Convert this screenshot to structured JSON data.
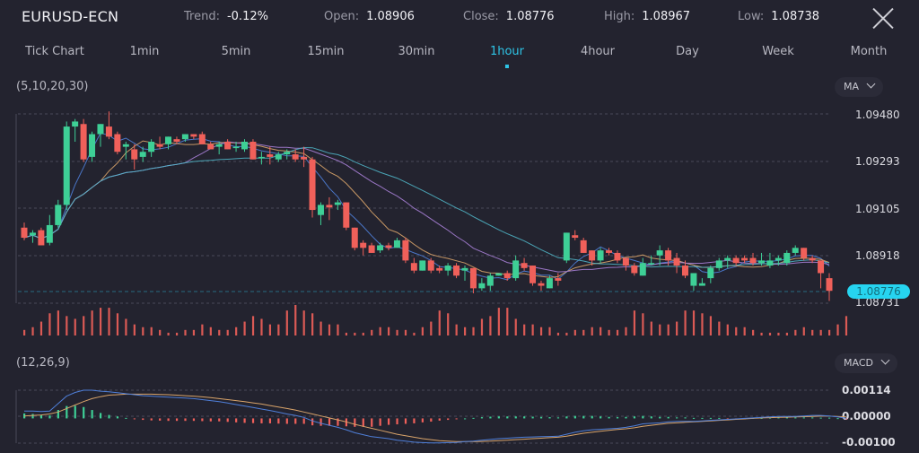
{
  "header": {
    "symbol": "EURUSD-ECN",
    "trend_label": "Trend:",
    "trend_value": "-0.12%",
    "open_label": "Open:",
    "open_value": "1.08906",
    "close_label": "Close:",
    "close_value": "1.08776",
    "high_label": "High:",
    "high_value": "1.08967",
    "low_label": "Low:",
    "low_value": "1.08738",
    "close_icon": "close-x-icon"
  },
  "timeframes": [
    "Tick Chart",
    "1min",
    "5min",
    "15min",
    "30min",
    "1hour",
    "4hour",
    "Day",
    "Week",
    "Month"
  ],
  "active_timeframe": "1hour",
  "colors": {
    "up": "#3ecf96",
    "down": "#f0605a",
    "accent": "#2ec4e6",
    "ma5": "#4f7fd9",
    "ma10": "#d9a46a",
    "ma20": "#a77fd6",
    "ma30": "#4fb3c4",
    "macd": "#4f7fd9",
    "signal": "#d9a46a"
  },
  "main_panel": {
    "params_label": "(5,10,20,30)",
    "indicator_select": "MA"
  },
  "macd_panel": {
    "params_label": "(12,26,9)",
    "indicator_select": "MACD"
  },
  "chart_data": [
    {
      "type": "candlestick",
      "title": "EURUSD-ECN 1hour",
      "y_ticks": [
        "1.09480",
        "1.09293",
        "1.09105",
        "1.08918",
        "1.08731"
      ],
      "current_price": "1.08776",
      "ylim": [
        1.08731,
        1.0948
      ],
      "candles": [
        [
          1.0903,
          1.0905,
          1.0898,
          1.0899
        ],
        [
          1.09,
          1.0902,
          1.0897,
          1.0901
        ],
        [
          1.0902,
          1.0903,
          1.0896,
          1.0896
        ],
        [
          1.0897,
          1.0908,
          1.0896,
          1.0904
        ],
        [
          1.0904,
          1.0914,
          1.0903,
          1.0912
        ],
        [
          1.0912,
          1.0945,
          1.091,
          1.0943
        ],
        [
          1.0943,
          1.0946,
          1.0937,
          1.0945
        ],
        [
          1.0944,
          1.0946,
          1.0929,
          1.093
        ],
        [
          1.0931,
          1.0941,
          1.0929,
          1.094
        ],
        [
          1.094,
          1.0944,
          1.0935,
          1.0944
        ],
        [
          1.0943,
          1.0949,
          1.0938,
          1.0939
        ],
        [
          1.094,
          1.0941,
          1.0932,
          1.0933
        ],
        [
          1.0935,
          1.0937,
          1.093,
          1.0936
        ],
        [
          1.0934,
          1.0936,
          1.0926,
          1.093
        ],
        [
          1.0931,
          1.0935,
          1.0929,
          1.0933
        ],
        [
          1.0933,
          1.0938,
          1.0931,
          1.0937
        ],
        [
          1.0936,
          1.0939,
          1.0934,
          1.0935
        ],
        [
          1.0936,
          1.0939,
          1.0934,
          1.0939
        ],
        [
          1.0938,
          1.0939,
          1.0936,
          1.0937
        ],
        [
          1.0938,
          1.094,
          1.0937,
          1.094
        ],
        [
          1.094,
          1.094,
          1.0938,
          1.0939
        ],
        [
          1.094,
          1.0941,
          1.0936,
          1.0936
        ],
        [
          1.0936,
          1.0937,
          1.0934,
          1.0934
        ],
        [
          1.0935,
          1.0937,
          1.0932,
          1.0936
        ],
        [
          1.0937,
          1.0938,
          1.0934,
          1.0934
        ],
        [
          1.0935,
          1.0937,
          1.0933,
          1.0935
        ],
        [
          1.0934,
          1.0938,
          1.0933,
          1.0937
        ],
        [
          1.0937,
          1.0938,
          1.093,
          1.093
        ],
        [
          1.0931,
          1.0933,
          1.0928,
          1.0931
        ],
        [
          1.0932,
          1.0935,
          1.0928,
          1.0931
        ],
        [
          1.093,
          1.0933,
          1.0929,
          1.0932
        ],
        [
          1.0932,
          1.0934,
          1.093,
          1.0933
        ],
        [
          1.0932,
          1.0934,
          1.0929,
          1.093
        ],
        [
          1.0931,
          1.0935,
          1.0927,
          1.093
        ],
        [
          1.093,
          1.0931,
          1.0907,
          1.091
        ],
        [
          1.0908,
          1.0913,
          1.0904,
          1.0912
        ],
        [
          1.0912,
          1.0915,
          1.0906,
          1.0911
        ],
        [
          1.0912,
          1.0914,
          1.091,
          1.0913
        ],
        [
          1.0913,
          1.0913,
          1.0902,
          1.0903
        ],
        [
          1.0903,
          1.0903,
          1.0894,
          1.0895
        ],
        [
          1.0897,
          1.0898,
          1.0892,
          1.0895
        ],
        [
          1.0896,
          1.0897,
          1.0893,
          1.0893
        ],
        [
          1.0894,
          1.0897,
          1.0893,
          1.0896
        ],
        [
          1.0896,
          1.0897,
          1.0894,
          1.0895
        ],
        [
          1.0895,
          1.0899,
          1.0895,
          1.0898
        ],
        [
          1.0898,
          1.0899,
          1.0889,
          1.089
        ],
        [
          1.0889,
          1.0891,
          1.0885,
          1.0886
        ],
        [
          1.0886,
          1.089,
          1.0886,
          1.089
        ],
        [
          1.089,
          1.0891,
          1.0885,
          1.0886
        ],
        [
          1.0887,
          1.0888,
          1.0885,
          1.0886
        ],
        [
          1.0886,
          1.0889,
          1.0884,
          1.0888
        ],
        [
          1.0888,
          1.0889,
          1.0883,
          1.0884
        ],
        [
          1.0886,
          1.0888,
          1.0882,
          1.0887
        ],
        [
          1.0887,
          1.0887,
          1.0877,
          1.0879
        ],
        [
          1.0879,
          1.0883,
          1.0878,
          1.0881
        ],
        [
          1.088,
          1.0885,
          1.0878,
          1.0884
        ],
        [
          1.0884,
          1.0885,
          1.0884,
          1.0885
        ],
        [
          1.0885,
          1.0886,
          1.0882,
          1.0883
        ],
        [
          1.0883,
          1.0892,
          1.0882,
          1.089
        ],
        [
          1.0889,
          1.0891,
          1.0886,
          1.0887
        ],
        [
          1.0888,
          1.0888,
          1.088,
          1.0881
        ],
        [
          1.0881,
          1.0882,
          1.0878,
          1.088
        ],
        [
          1.0879,
          1.0884,
          1.0879,
          1.0883
        ],
        [
          1.0883,
          1.0885,
          1.088,
          1.0882
        ],
        [
          1.089,
          1.0901,
          1.0889,
          1.0901
        ],
        [
          1.09,
          1.0902,
          1.0898,
          1.0899
        ],
        [
          1.0898,
          1.0899,
          1.0893,
          1.0893
        ],
        [
          1.0894,
          1.0894,
          1.0888,
          1.089
        ],
        [
          1.089,
          1.0895,
          1.0889,
          1.0894
        ],
        [
          1.0894,
          1.0895,
          1.0892,
          1.0893
        ],
        [
          1.0893,
          1.0894,
          1.0889,
          1.089
        ],
        [
          1.0891,
          1.0891,
          1.0886,
          1.0888
        ],
        [
          1.0888,
          1.0889,
          1.0884,
          1.0885
        ],
        [
          1.0884,
          1.0891,
          1.0884,
          1.0889
        ],
        [
          1.0889,
          1.0892,
          1.0888,
          1.0889
        ],
        [
          1.0892,
          1.0896,
          1.0888,
          1.0894
        ],
        [
          1.0894,
          1.0895,
          1.0888,
          1.089
        ],
        [
          1.0891,
          1.0893,
          1.0885,
          1.0888
        ],
        [
          1.0888,
          1.089,
          1.0883,
          1.0884
        ],
        [
          1.088,
          1.0885,
          1.0878,
          1.0885
        ],
        [
          1.088,
          1.0883,
          1.088,
          1.0881
        ],
        [
          1.0883,
          1.0888,
          1.0881,
          1.0887
        ],
        [
          1.0887,
          1.0891,
          1.0886,
          1.089
        ],
        [
          1.089,
          1.0892,
          1.0887,
          1.0891
        ],
        [
          1.0891,
          1.0892,
          1.0888,
          1.0889
        ],
        [
          1.0891,
          1.0892,
          1.0889,
          1.089
        ],
        [
          1.0891,
          1.0893,
          1.0888,
          1.0889
        ],
        [
          1.0889,
          1.0893,
          1.0888,
          1.089
        ],
        [
          1.0888,
          1.0893,
          1.0887,
          1.089
        ],
        [
          1.089,
          1.0892,
          1.0888,
          1.0891
        ],
        [
          1.0889,
          1.0894,
          1.0888,
          1.0893
        ],
        [
          1.0893,
          1.0896,
          1.0892,
          1.0895
        ],
        [
          1.0895,
          1.0895,
          1.089,
          1.0891
        ],
        [
          1.0891,
          1.0892,
          1.0889,
          1.089
        ],
        [
          1.089,
          1.089,
          1.0879,
          1.0885
        ],
        [
          1.0883,
          1.0885,
          1.0874,
          1.0878
        ]
      ],
      "volume": [
        2,
        3,
        5,
        8,
        9,
        7,
        6,
        7,
        9,
        10,
        10,
        8,
        6,
        4,
        3,
        3,
        2,
        1,
        1,
        2,
        2,
        4,
        3,
        2,
        2,
        3,
        5,
        7,
        6,
        4,
        4,
        9,
        11,
        9,
        8,
        5,
        4,
        4,
        1,
        1,
        1,
        2,
        3,
        3,
        2,
        2,
        1,
        3,
        5,
        9,
        8,
        4,
        3,
        3,
        6,
        7,
        10,
        10,
        6,
        4,
        4,
        3,
        3,
        1,
        1,
        2,
        2,
        3,
        3,
        2,
        2,
        3,
        9,
        8,
        5,
        4,
        4,
        5,
        9,
        9,
        8,
        7,
        5,
        4,
        3,
        3,
        2,
        1,
        1,
        1,
        1,
        2,
        3,
        2,
        2,
        2,
        4,
        7
      ],
      "moving_averages": [
        "MA5",
        "MA10",
        "MA20",
        "MA30"
      ]
    },
    {
      "type": "macd",
      "title": "MACD (12,26,9)",
      "y_ticks": [
        "0.00114",
        "0.00000",
        "-0.00100"
      ],
      "ylim": [
        -0.001,
        0.00114
      ],
      "macd_line": [
        0.0003,
        0.0003,
        0.00028,
        0.0003,
        0.0006,
        0.0009,
        0.00105,
        0.00114,
        0.00114,
        0.0011,
        0.00108,
        0.00104,
        0.001,
        0.00096,
        0.00092,
        0.0009,
        0.00088,
        0.00086,
        0.00084,
        0.00082,
        0.0008,
        0.00076,
        0.00072,
        0.00068,
        0.00062,
        0.00056,
        0.0005,
        0.00044,
        0.00038,
        0.00032,
        0.00025,
        0.00018,
        0.00012,
        4e-05,
        -0.0001,
        -0.0002,
        -0.00028,
        -0.00036,
        -0.00046,
        -0.00058,
        -0.00066,
        -0.00074,
        -0.00078,
        -0.00082,
        -0.00088,
        -0.00092,
        -0.00096,
        -0.00098,
        -0.00099,
        -0.00099,
        -0.00098,
        -0.00097,
        -0.00094,
        -0.00092,
        -0.00088,
        -0.00085,
        -0.00082,
        -0.0008,
        -0.00078,
        -0.00076,
        -0.00075,
        -0.00074,
        -0.00073,
        -0.00072,
        -0.00064,
        -0.00056,
        -0.0005,
        -0.00046,
        -0.00044,
        -0.00042,
        -0.0004,
        -0.00036,
        -0.0003,
        -0.00022,
        -0.0002,
        -0.00018,
        -0.00014,
        -0.00012,
        -0.00012,
        -0.00012,
        -0.0001,
        -8e-05,
        -6e-05,
        -4e-05,
        -2e-05,
        0.0,
        2e-05,
        4e-05,
        6e-05,
        8e-05,
        8e-05,
        8e-05,
        0.0001,
        0.00012,
        0.00012,
        0.0001,
        6e-05,
        0.0
      ],
      "signal_line": [
        0.0001,
        0.00012,
        0.00014,
        0.00018,
        0.00026,
        0.0004,
        0.00054,
        0.00068,
        0.0008,
        0.00088,
        0.00094,
        0.00096,
        0.00098,
        0.00098,
        0.00098,
        0.00098,
        0.00097,
        0.00096,
        0.00094,
        0.00092,
        0.0009,
        0.00087,
        0.00084,
        0.0008,
        0.00076,
        0.00072,
        0.00068,
        0.00063,
        0.00058,
        0.00052,
        0.00046,
        0.0004,
        0.00034,
        0.00026,
        0.00018,
        0.0001,
        2e-05,
        -6e-05,
        -0.00014,
        -0.00024,
        -0.00032,
        -0.0004,
        -0.00048,
        -0.00056,
        -0.00064,
        -0.0007,
        -0.00076,
        -0.00082,
        -0.00086,
        -0.0009,
        -0.00092,
        -0.00094,
        -0.00094,
        -0.00094,
        -0.00093,
        -0.00092,
        -0.0009,
        -0.00088,
        -0.00086,
        -0.00084,
        -0.00082,
        -0.0008,
        -0.00078,
        -0.00076,
        -0.00072,
        -0.00066,
        -0.0006,
        -0.00056,
        -0.00052,
        -0.00048,
        -0.00045,
        -0.00042,
        -0.00038,
        -0.00032,
        -0.00028,
        -0.00024,
        -0.0002,
        -0.00018,
        -0.00016,
        -0.00014,
        -0.00012,
        -0.0001,
        -8e-05,
        -6e-05,
        -4e-05,
        -2e-05,
        0.0,
        2e-05,
        3e-05,
        4e-05,
        5e-05,
        6e-05,
        7e-05,
        8e-05,
        9e-05,
        9e-05,
        8e-05,
        6e-05
      ],
      "histogram": [
        0.0002,
        0.00018,
        0.00014,
        0.00012,
        0.00034,
        0.0005,
        0.00051,
        0.00046,
        0.00034,
        0.00022,
        0.00014,
        8e-05,
        2e-05,
        -2e-05,
        -6e-05,
        -8e-05,
        -9e-05,
        -0.0001,
        -0.0001,
        -0.0001,
        -0.0001,
        -0.00011,
        -0.00012,
        -0.00012,
        -0.00014,
        -0.00016,
        -0.00018,
        -0.00019,
        -0.0002,
        -0.0002,
        -0.00021,
        -0.00022,
        -0.00022,
        -0.00022,
        -0.00028,
        -0.0003,
        -0.0003,
        -0.0003,
        -0.00032,
        -0.00034,
        -0.00034,
        -0.00034,
        -0.0003,
        -0.00026,
        -0.00024,
        -0.00022,
        -0.0002,
        -0.00016,
        -0.00013,
        -9e-05,
        -6e-05,
        -3e-05,
        0.0,
        2e-05,
        5e-05,
        7e-05,
        8e-05,
        8e-05,
        8e-05,
        8e-05,
        7e-05,
        6e-05,
        5e-05,
        4e-05,
        8e-05,
        0.0001,
        0.0001,
        0.0001,
        8e-05,
        6e-05,
        5e-05,
        6e-05,
        8e-05,
        0.0001,
        8e-05,
        6e-05,
        6e-05,
        4e-05,
        4e-05,
        2e-05,
        2e-05,
        2e-05,
        2e-05,
        -2e-05,
        -2e-05,
        -2e-05,
        2e-05,
        2e-05,
        3e-05,
        4e-05,
        4e-05,
        4e-05,
        4e-05,
        4e-05,
        3e-05,
        3e-05,
        1e-05,
        -2e-05
      ]
    }
  ]
}
